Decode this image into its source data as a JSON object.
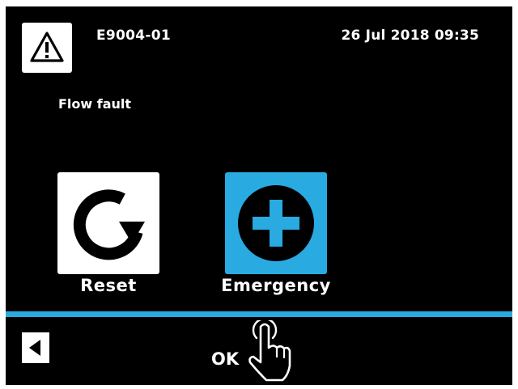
{
  "header": {
    "warning_icon": "warning-triangle-icon",
    "error_code": "E9004-01",
    "timestamp": "26 Jul 2018 09:35"
  },
  "alarm": {
    "message": "Flow fault"
  },
  "actions": [
    {
      "label": "Reset",
      "icon": "reset-arrow-icon",
      "tile_color": "#ffffff"
    },
    {
      "label": "Emergency",
      "icon": "plus-circle-icon",
      "tile_color": "#29aae1"
    }
  ],
  "footer": {
    "back_icon": "back-arrow-icon",
    "ok_label": "OK",
    "pointer_icon": "pointing-hand-icon"
  },
  "colors": {
    "background": "#000000",
    "accent": "#29aae1",
    "text": "#ffffff"
  }
}
